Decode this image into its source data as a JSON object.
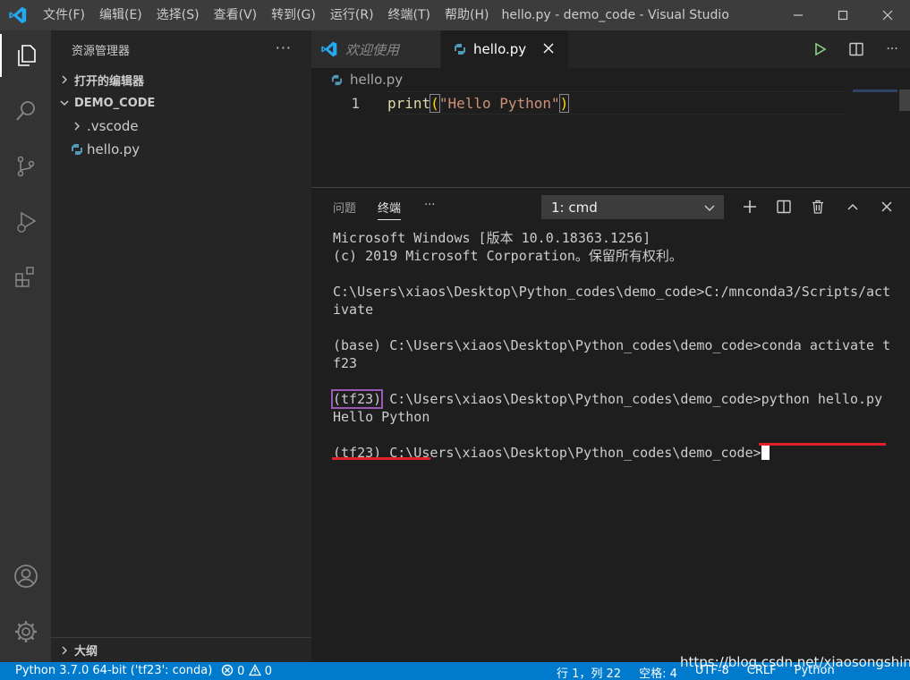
{
  "window": {
    "menu": [
      "文件(F)",
      "编辑(E)",
      "选择(S)",
      "查看(V)",
      "转到(G)",
      "运行(R)",
      "终端(T)",
      "帮助(H)"
    ],
    "title": "hello.py - demo_code - Visual Studio ..."
  },
  "sidebar": {
    "title": "资源管理器",
    "more": "···",
    "open_editors": "打开的编辑器",
    "folder": "DEMO_CODE",
    "items": [
      ".vscode",
      "hello.py"
    ],
    "outline": "大纲"
  },
  "tabs": [
    {
      "label": "欢迎使用"
    },
    {
      "label": "hello.py"
    }
  ],
  "editor": {
    "breadcrumb": "hello.py",
    "line_number": "1",
    "code": {
      "fn": "print",
      "open": "(",
      "str": "\"Hello Python\"",
      "close": ")"
    }
  },
  "panel": {
    "tabs": [
      "问题",
      "终端",
      "···"
    ],
    "terminal_select": "1: cmd",
    "terminal": {
      "line1": "Microsoft Windows [版本 10.0.18363.1256]",
      "line2": "(c) 2019 Microsoft Corporation。保留所有权利。",
      "line3": "C:\\Users\\xiaos\\Desktop\\Python_codes\\demo_code>C:/mnconda3/Scripts/act",
      "line4": "ivate",
      "line5": "(base) C:\\Users\\xiaos\\Desktop\\Python_codes\\demo_code>conda activate t",
      "line6": "f23",
      "env": "(tf23)",
      "line7_path": " C:\\Users\\xiaos\\Desktop\\Python_codes\\demo_code>",
      "line7_cmd": "python hello.py",
      "line8": "Hello Python",
      "line9": "(tf23) C:\\Users\\xiaos\\Desktop\\Python_codes\\demo_code>"
    }
  },
  "statusbar": {
    "interpreter": "Python 3.7.0 64-bit ('tf23': conda)",
    "errors": "0",
    "warnings": "0",
    "position": "行 1，列 22",
    "indent": "空格: 4",
    "encoding": "UTF-8",
    "eol": "CRLF",
    "language": "Python"
  },
  "watermark": "https://blog.csdn.net/xiaosongshine",
  "colors": {
    "accent": "#007acc",
    "annotation_red": "#e0202a",
    "annotation_purple": "#9b59b6",
    "string": "#ce9178",
    "function": "#dcdcaa"
  }
}
